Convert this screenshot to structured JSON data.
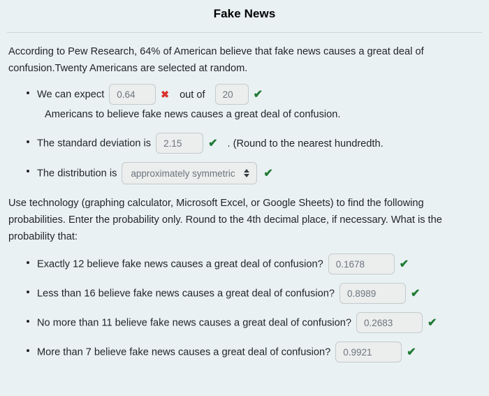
{
  "header": {
    "title": "Fake News"
  },
  "intro": {
    "paragraph": "According to Pew Research, 64% of American believe that fake news causes a great deal of confusion.Twenty Americans are selected at random."
  },
  "first_section": {
    "items": [
      {
        "lead_text": "We can expect",
        "expected_value": "0.64",
        "expected_mark": "✖",
        "middle_text": "out of",
        "trials_value": "20",
        "trials_mark": "✔",
        "trailing_text": "Americans to believe fake news causes a great deal of confusion."
      },
      {
        "lead_text": "The standard deviation is",
        "value": "2.15",
        "mark": "✔",
        "trailing_text": ". (Round to the nearest hundredth."
      },
      {
        "lead_text": "The distribution is",
        "selected_option": "approximately symmetric",
        "options": [
          "approximately symmetric"
        ],
        "mark": "✔"
      }
    ]
  },
  "technology_note": {
    "paragraph": "Use technology (graphing calculator, Microsoft Excel, or Google Sheets) to find the following probabilities. Enter the probability only. Round to the 4th decimal place, if necessary. What is the probability that:"
  },
  "probability_questions": {
    "items": [
      {
        "question": "Exactly 12 believe fake news causes a great deal of confusion?",
        "value": "0.1678",
        "mark": "✔"
      },
      {
        "question": "Less than 16 believe fake news causes a great deal of confusion?",
        "value": "0.8989",
        "mark": "✔"
      },
      {
        "question": "No more than 11 believe fake news causes a great deal of confusion?",
        "value": "0.2683",
        "mark": "✔"
      },
      {
        "question": "More than 7 believe fake news causes a great deal of confusion?",
        "value": "0.9921",
        "mark": "✔"
      }
    ]
  },
  "colors": {
    "background": "#e9f1f3",
    "correct_green": "#1f7a35",
    "incorrect_red": "#d9302c",
    "input_fill": "#eceded",
    "input_border": "#c3cbcc",
    "text": "#212529"
  }
}
